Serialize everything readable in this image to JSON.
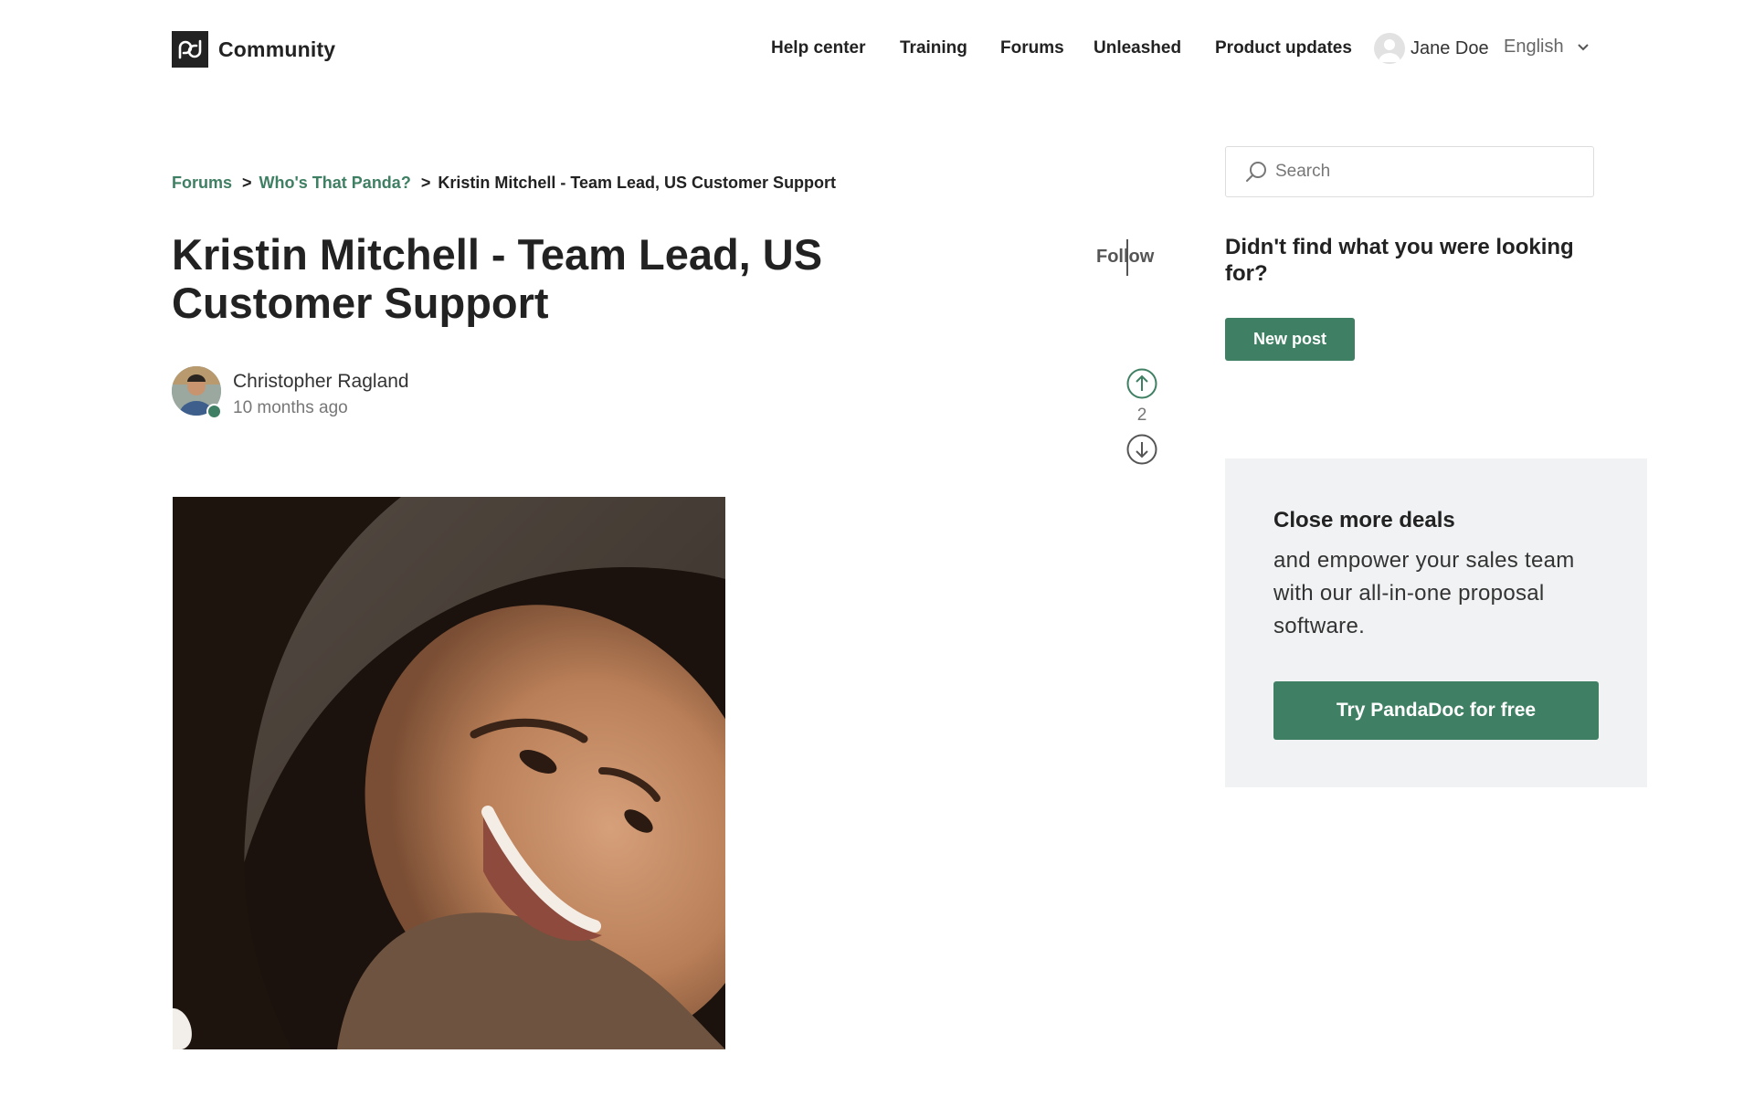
{
  "header": {
    "logo_text": "Community",
    "nav": [
      {
        "label": "Help center"
      },
      {
        "label": "Training"
      },
      {
        "label": "Forums"
      },
      {
        "label": "Unleashed"
      },
      {
        "label": "Product updates"
      }
    ],
    "user_name": "Jane Doe",
    "language": "English"
  },
  "breadcrumb": {
    "items": [
      "Forums",
      "Who's That Panda?"
    ],
    "separator": ">",
    "current": "Kristin Mitchell - Team Lead, US Customer Support"
  },
  "post": {
    "title": "Kristin Mitchell - Team Lead, US Customer Support",
    "follow_label": "Follow",
    "author": "Christopher Ragland",
    "time_ago": "10 months ago",
    "vote_count": "2"
  },
  "sidebar": {
    "search_placeholder": "Search",
    "heading": "Didn't find what you were looking for?",
    "new_post_label": "New post",
    "promo": {
      "title": "Close more deals",
      "body": "and empower your sales team with our all-in-one proposal software.",
      "cta_label": "Try PandaDoc for free"
    }
  },
  "colors": {
    "accent_green": "#3f7f63",
    "text_dark": "#222222",
    "promo_bg": "#f1f2f3"
  },
  "icons": [
    "pandadoc-logo-icon",
    "user-avatar-icon",
    "chevron-down-icon",
    "arrow-up-circle-icon",
    "arrow-down-circle-icon",
    "search-icon"
  ]
}
